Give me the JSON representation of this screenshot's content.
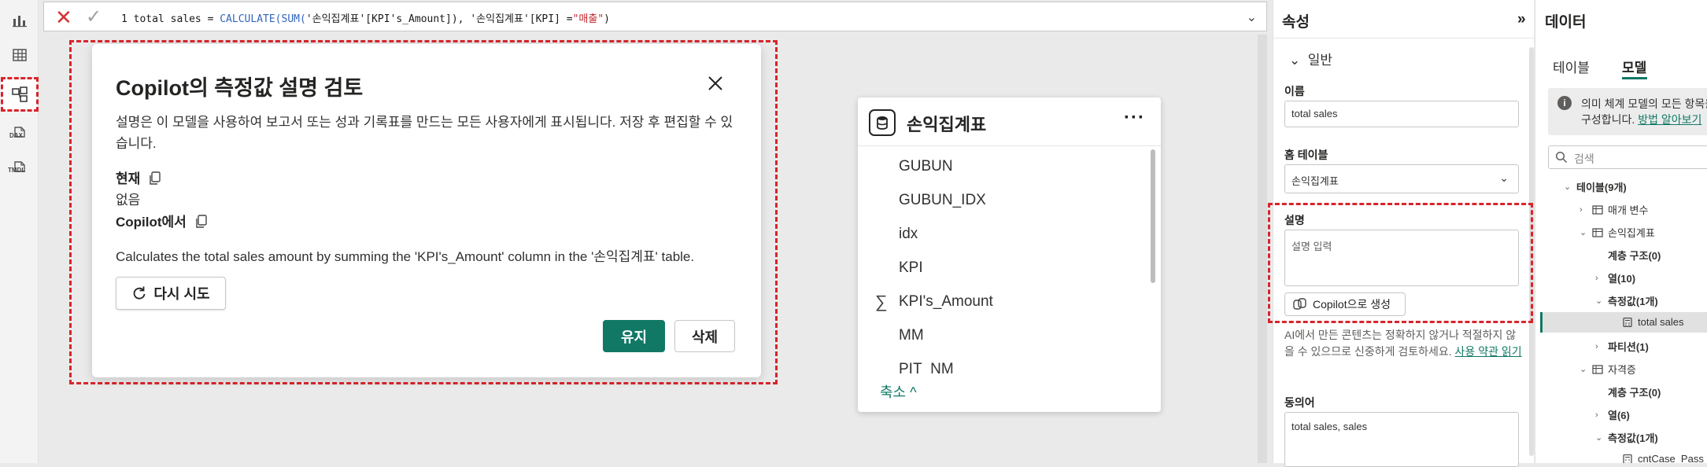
{
  "formula_bar": {
    "line_no": "1",
    "measure_name": "total sales",
    "op": " = ",
    "fn": "CALCULATE(SUM(",
    "arg1": "'손익집계표'[KPI's_Amount]",
    "mid": "), '손익집계표'[KPI] =",
    "literal": "\"매출\"",
    "end": ")",
    "cancel_icon": "close-icon",
    "commit_icon": "check-icon"
  },
  "rail": {
    "items": [
      "report-view-icon",
      "table-view-icon",
      "model-view-icon",
      "dax-query-icon",
      "tmdl-view-icon"
    ],
    "dax_label": "DAX",
    "tmdl_label": "TMDL"
  },
  "dialog": {
    "title": "Copilot의 측정값 설명 검토",
    "description": "설명은 이 모델을 사용하여 보고서 또는 성과 기록표를 만드는 모든 사용자에게 표시됩니다. 저장 후 편집할 수 있습니다.",
    "current_label": "현재",
    "current_value": "없음",
    "copilot_label": "Copilot에서",
    "copilot_value": "Calculates the total sales amount by summing the 'KPI's_Amount' column in the '손익집계표' table.",
    "retry_label": "다시 시도",
    "keep_label": "유지",
    "delete_label": "삭제"
  },
  "table_card": {
    "name": "손익집계표",
    "more": "···",
    "columns": [
      "GUBUN",
      "GUBUN_IDX",
      "idx",
      "KPI",
      "KPI's_Amount",
      "MM",
      "PIT_NM"
    ],
    "collapse_label": "축소 ^"
  },
  "properties": {
    "title": "속성",
    "expand_icon": "»",
    "section": "일반",
    "name_label": "이름",
    "name_value": "total sales",
    "home_table_label": "홈 테이블",
    "home_table_value": "손익집계표",
    "description_label": "설명",
    "description_placeholder": "설명 입력",
    "copilot_button": "Copilot으로 생성",
    "ai_note_text": "AI에서 만든 콘텐츠는 정확하지 않거나 적절하지 않을 수 있으므로 신중하게 검토하세요. ",
    "ai_note_link": "사용 약관 읽기",
    "synonyms_label": "동의어",
    "synonyms_value": "total sales, sales"
  },
  "data_pane": {
    "title": "데이터",
    "tab_table": "테이블",
    "tab_model": "모델",
    "info_line1": "의미 체계 모델의 모든 항목을",
    "info_line2": "구성합니다. ",
    "info_link": "방법 알아보기",
    "search_placeholder": "검색",
    "tree": {
      "tables": "테이블(9개)",
      "params": "매개 변수",
      "t1": "손익집계표",
      "t1_hier": "계층 구조(0)",
      "t1_cols": "열(10)",
      "t1_measures": "측정값(1개)",
      "t1_measure_item": "total sales",
      "t1_partitions": "파티션(1)",
      "t2": "자격증",
      "t2_hier": "계층 구조(0)",
      "t2_cols": "열(6)",
      "t2_measures": "측정값(1개)",
      "t2_measure_item": "cntCase_Pass"
    }
  },
  "colors": {
    "accent": "#117865",
    "highlight_outline": "#d8242b",
    "formula_function": "#3165bb",
    "formula_string": "#c1272d"
  }
}
